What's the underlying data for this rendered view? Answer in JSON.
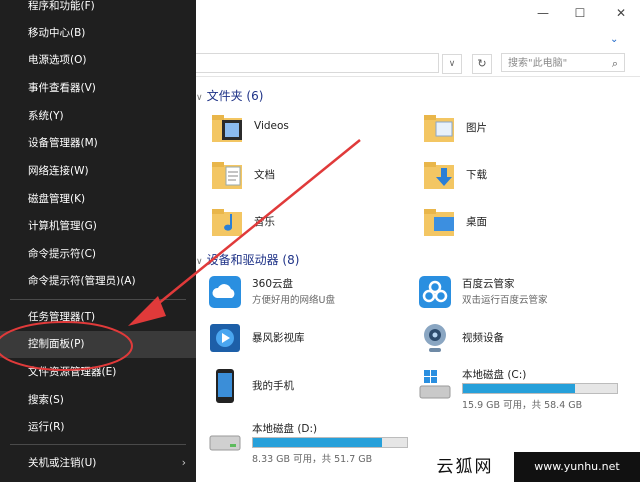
{
  "menu": {
    "items": [
      {
        "label": "程序和功能(F)"
      },
      {
        "label": "移动中心(B)"
      },
      {
        "label": "电源选项(O)"
      },
      {
        "label": "事件查看器(V)"
      },
      {
        "label": "系统(Y)"
      },
      {
        "label": "设备管理器(M)"
      },
      {
        "label": "网络连接(W)"
      },
      {
        "label": "磁盘管理(K)"
      },
      {
        "label": "计算机管理(G)"
      },
      {
        "label": "命令提示符(C)"
      },
      {
        "label": "命令提示符(管理员)(A)"
      },
      {
        "label": "任务管理器(T)"
      },
      {
        "label": "控制面板(P)",
        "highlighted": true
      },
      {
        "label": "文件资源管理器(E)"
      },
      {
        "label": "搜索(S)"
      },
      {
        "label": "运行(R)"
      },
      {
        "label": "关机或注销(U)"
      }
    ]
  },
  "window": {
    "minimize": "—",
    "maximize": "☐",
    "close": "✕"
  },
  "toolbar": {
    "search_placeholder": "搜索\"此电脑\"",
    "refresh_icon": "↻"
  },
  "folders": {
    "header": "文件夹 (6)",
    "items": [
      {
        "name": "Videos",
        "icon": "videos-folder-icon"
      },
      {
        "name": "图片",
        "icon": "pictures-folder-icon"
      },
      {
        "name": "文档",
        "icon": "documents-folder-icon"
      },
      {
        "name": "下载",
        "icon": "downloads-folder-icon"
      },
      {
        "name": "音乐",
        "icon": "music-folder-icon"
      },
      {
        "name": "桌面",
        "icon": "desktop-folder-icon"
      }
    ]
  },
  "devices": {
    "header": "设备和驱动器 (8)",
    "items": [
      {
        "name": "360云盘",
        "sub": "方便好用的网络U盘",
        "icon": "cloud-360-icon"
      },
      {
        "name": "百度云管家",
        "sub": "双击运行百度云管家",
        "icon": "baidu-cloud-icon"
      },
      {
        "name": "暴风影视库",
        "icon": "baofeng-icon"
      },
      {
        "name": "视频设备",
        "icon": "webcam-icon"
      },
      {
        "name": "我的手机",
        "icon": "phone-icon"
      },
      {
        "name": "本地磁盘 (C:)",
        "sub": "15.9 GB 可用，共 58.4 GB",
        "used_fraction": 0.73,
        "icon": "windows-drive-icon"
      },
      {
        "name": "本地磁盘 (D:)",
        "sub": "8.33 GB 可用，共 51.7 GB",
        "used_fraction": 0.84,
        "icon": "hard-drive-icon"
      }
    ]
  },
  "watermark": {
    "left": "云狐网",
    "right": "www.yunhu.net"
  },
  "colors": {
    "menu_bg": "#1f1f1f",
    "accent_red": "#e03a3a",
    "drive_fill": "#26a0da",
    "header_blue": "#1e3287"
  }
}
